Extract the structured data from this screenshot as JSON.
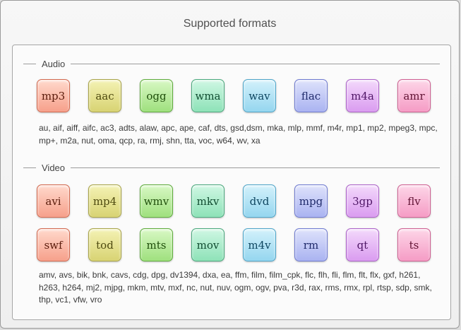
{
  "dialog": {
    "title": "Supported formats"
  },
  "audio": {
    "label": "Audio",
    "formats": [
      "mp3",
      "aac",
      "ogg",
      "wma",
      "wav",
      "flac",
      "m4a",
      "amr"
    ],
    "extensions": "au, aif, aiff, aifc, ac3, adts, alaw, apc, ape, caf, dts, gsd,dsm, mka, mlp, mmf, m4r, mp1, mp2, mpeg3, mpc, mp+, m2a, nut, oma, qcp, ra, rmj, shn, tta, voc, w64, wv, xa"
  },
  "video": {
    "label": "Video",
    "formats_row1": [
      "avi",
      "mp4",
      "wmv",
      "mkv",
      "dvd",
      "mpg",
      "3gp",
      "flv"
    ],
    "formats_row2": [
      "swf",
      "tod",
      "mts",
      "mov",
      "m4v",
      "rm",
      "qt",
      "ts"
    ],
    "extensions": "amv, avs, bik, bnk, cavs, cdg, dpg, dv1394, dxa, ea, ffm, film, film_cpk, flc, flh, fli, flm, flt, flx, gxf, h261, h263, h264, mj2, mjpg, mkm, mtv, mxf, nc, nut, nuv, ogm, ogv, pva, r3d, rax, rms, rmx, rpl, rtsp, sdp, smk, thp, vc1, vfw, vro"
  },
  "colors": [
    "#f6a08b",
    "#d8d373",
    "#9fe07e",
    "#8ee2b8",
    "#95d6ef",
    "#aab3f1",
    "#da9cf0",
    "#f59cc5"
  ]
}
